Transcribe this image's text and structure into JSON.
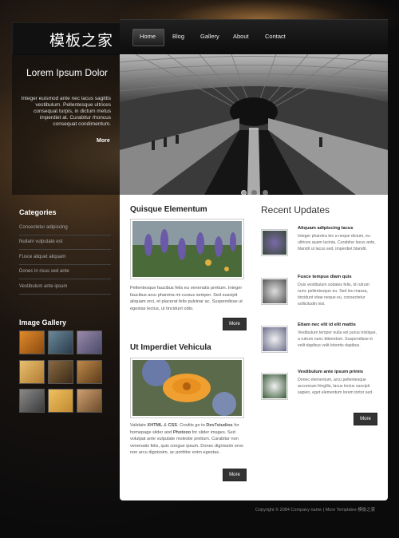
{
  "logo": {
    "text": "模板之家"
  },
  "nav": {
    "items": [
      "Home",
      "Blog",
      "Gallery",
      "About",
      "Contact"
    ]
  },
  "intro": {
    "title": "Lorem Ipsum Dolor",
    "text": "Integer euismod ante nec lacus sagittis vestibulum. Pellentesque ultrices consequat turpis, in dictum metus imperdiet at. Curabitur rhoncus consequat condimentum.",
    "more": "More"
  },
  "sidebar": {
    "categories_title": "Categories",
    "categories": [
      "Consectetur adipiscing",
      "Nullam vulputate est",
      "Fusce aliquet aliquam",
      "Donec in risus sed ante",
      "Vestibulum ante ipsum"
    ],
    "gallery_title": "Image Gallery"
  },
  "main": {
    "post1": {
      "title": "Quisque Elementum",
      "text": "Pellentesque faucibus felis eu venenatis pretium. Integer faucibus arcu pharetra mi cursus semper. Sed suscipit aliquam orci, et placerat felis pulvinar ac. Suspendisse ut egestas lectus, ut tincidunt odio.",
      "more": "More"
    },
    "post2": {
      "title": "Ut Imperdiet Vehicula",
      "text_a": "Validate ",
      "xhtml": "XHTML",
      "text_b": " & ",
      "css": "CSS",
      "text_c": ". Credits go to ",
      "dev7": "Dev7studios",
      "text_d": " for homepage slider and ",
      "photoxo": "Photoxo",
      "text_e": " for slider images. Sed volutpat ante vulputate molestie pretium. Curabitur non venenatis felis, quis congue ipsum. Donec dignissim eros non arcu dignissim, ac porttitor enim egestas.",
      "more": "More"
    },
    "recent_title": "Recent Updates",
    "updates": [
      {
        "title": "Aliquam adipiscing lacus",
        "text": "Integer pharetra leo a neque dictum, eu ultrices quam lacinia. Curabitur lacus ante, blandit ut lacus sed, imperdiet blandit."
      },
      {
        "title": "Fusce tempus diam quis",
        "text": "Duis vestibulum sodales felis, id rutrum nunc pellentesque eu. Sed leo massa, tincidunt vitae neque eu, consectetur sollicitudin nisi."
      },
      {
        "title": "Etiam nec elit id elit mattis",
        "text": "Vestibulum tempor nulla vel purus tristique, a rutrum nunc bibendum. Suspendisse in velit dapibus velit lobortis dapibus."
      },
      {
        "title": "Vestibulum ante ipsum primis",
        "text": "Donec elementum, arcu pellentesque accumsan fringilla, lacus lectus suscipit sapien, eget elementum lorem tortor sed."
      }
    ],
    "updates_more": "More"
  },
  "footer": {
    "text": "Copyright © 2084 Company name | More Templates 模板之家"
  },
  "colors": {
    "bg": "#0b0b0c",
    "content": "#ffffff",
    "button": "#333333",
    "accent_glow": "#dcaa6e"
  }
}
